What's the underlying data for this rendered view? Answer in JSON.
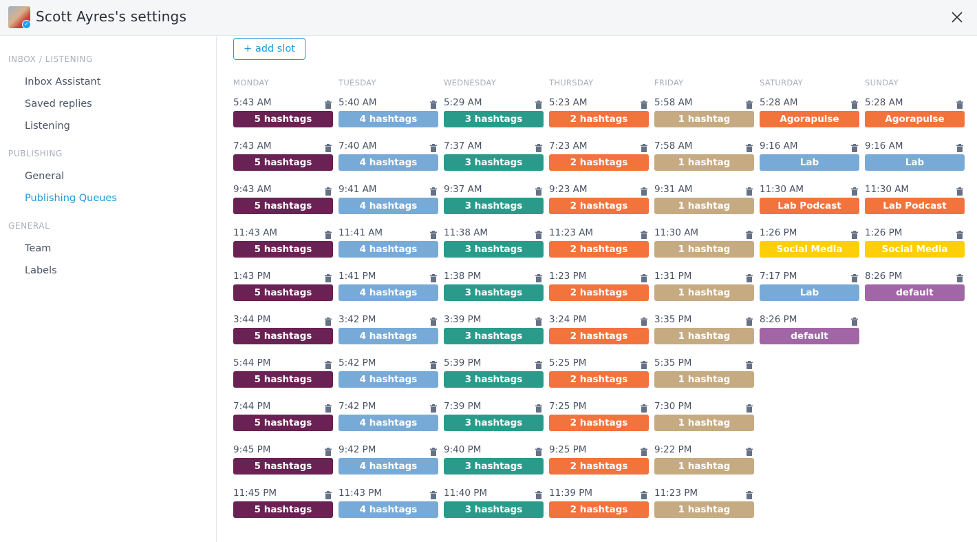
{
  "header": {
    "title": "Scott Ayres's settings",
    "badge_icon": "twitter-icon"
  },
  "sidebar": {
    "sections": [
      {
        "label": "INBOX / LISTENING",
        "items": [
          {
            "label": "Inbox Assistant",
            "active": false
          },
          {
            "label": "Saved replies",
            "active": false
          },
          {
            "label": "Listening",
            "active": false
          }
        ]
      },
      {
        "label": "PUBLISHING",
        "items": [
          {
            "label": "General",
            "active": false
          },
          {
            "label": "Publishing Queues",
            "active": true
          }
        ]
      },
      {
        "label": "GENERAL",
        "items": [
          {
            "label": "Team",
            "active": false
          },
          {
            "label": "Labels",
            "active": false
          }
        ]
      }
    ]
  },
  "main": {
    "add_slot_label": "+ add slot"
  },
  "queue_colors": {
    "5 hashtags": "#6a2153",
    "4 hashtags": "#78aad8",
    "3 hashtags": "#2a9b8b",
    "2 hashtags": "#f3733d",
    "1 hashtag": "#c6aa82",
    "Agorapulse": "#f3733d",
    "Lab": "#78aad8",
    "Lab Podcast": "#f3733d",
    "Social Media": "#fdcf06",
    "default": "#a166a6"
  },
  "days": [
    {
      "name": "MONDAY",
      "slots": [
        {
          "time": "5:43 AM",
          "queue": "5 hashtags"
        },
        {
          "time": "7:43 AM",
          "queue": "5 hashtags"
        },
        {
          "time": "9:43 AM",
          "queue": "5 hashtags"
        },
        {
          "time": "11:43 AM",
          "queue": "5 hashtags"
        },
        {
          "time": "1:43 PM",
          "queue": "5 hashtags"
        },
        {
          "time": "3:44 PM",
          "queue": "5 hashtags"
        },
        {
          "time": "5:44 PM",
          "queue": "5 hashtags"
        },
        {
          "time": "7:44 PM",
          "queue": "5 hashtags"
        },
        {
          "time": "9:45 PM",
          "queue": "5 hashtags"
        },
        {
          "time": "11:45 PM",
          "queue": "5 hashtags"
        }
      ]
    },
    {
      "name": "TUESDAY",
      "slots": [
        {
          "time": "5:40 AM",
          "queue": "4 hashtags"
        },
        {
          "time": "7:40 AM",
          "queue": "4 hashtags"
        },
        {
          "time": "9:41 AM",
          "queue": "4 hashtags"
        },
        {
          "time": "11:41 AM",
          "queue": "4 hashtags"
        },
        {
          "time": "1:41 PM",
          "queue": "4 hashtags"
        },
        {
          "time": "3:42 PM",
          "queue": "4 hashtags"
        },
        {
          "time": "5:42 PM",
          "queue": "4 hashtags"
        },
        {
          "time": "7:42 PM",
          "queue": "4 hashtags"
        },
        {
          "time": "9:42 PM",
          "queue": "4 hashtags"
        },
        {
          "time": "11:43 PM",
          "queue": "4 hashtags"
        }
      ]
    },
    {
      "name": "WEDNESDAY",
      "slots": [
        {
          "time": "5:29 AM",
          "queue": "3 hashtags"
        },
        {
          "time": "7:37 AM",
          "queue": "3 hashtags"
        },
        {
          "time": "9:37 AM",
          "queue": "3 hashtags"
        },
        {
          "time": "11:38 AM",
          "queue": "3 hashtags"
        },
        {
          "time": "1:38 PM",
          "queue": "3 hashtags"
        },
        {
          "time": "3:39 PM",
          "queue": "3 hashtags"
        },
        {
          "time": "5:39 PM",
          "queue": "3 hashtags"
        },
        {
          "time": "7:39 PM",
          "queue": "3 hashtags"
        },
        {
          "time": "9:40 PM",
          "queue": "3 hashtags"
        },
        {
          "time": "11:40 PM",
          "queue": "3 hashtags"
        }
      ]
    },
    {
      "name": "THURSDAY",
      "slots": [
        {
          "time": "5:23 AM",
          "queue": "2 hashtags"
        },
        {
          "time": "7:23 AM",
          "queue": "2 hashtags"
        },
        {
          "time": "9:23 AM",
          "queue": "2 hashtags"
        },
        {
          "time": "11:23 AM",
          "queue": "2 hashtags"
        },
        {
          "time": "1:23 PM",
          "queue": "2 hashtags"
        },
        {
          "time": "3:24 PM",
          "queue": "2 hashtags"
        },
        {
          "time": "5:25 PM",
          "queue": "2 hashtags"
        },
        {
          "time": "7:25 PM",
          "queue": "2 hashtags"
        },
        {
          "time": "9:25 PM",
          "queue": "2 hashtags"
        },
        {
          "time": "11:39 PM",
          "queue": "2 hashtags"
        }
      ]
    },
    {
      "name": "FRIDAY",
      "slots": [
        {
          "time": "5:58 AM",
          "queue": "1 hashtag"
        },
        {
          "time": "7:58 AM",
          "queue": "1 hashtag"
        },
        {
          "time": "9:31 AM",
          "queue": "1 hashtag"
        },
        {
          "time": "11:30 AM",
          "queue": "1 hashtag"
        },
        {
          "time": "1:31 PM",
          "queue": "1 hashtag"
        },
        {
          "time": "3:35 PM",
          "queue": "1 hashtag"
        },
        {
          "time": "5:35 PM",
          "queue": "1 hashtag"
        },
        {
          "time": "7:30 PM",
          "queue": "1 hashtag"
        },
        {
          "time": "9:22 PM",
          "queue": "1 hashtag"
        },
        {
          "time": "11:23 PM",
          "queue": "1 hashtag"
        }
      ]
    },
    {
      "name": "SATURDAY",
      "slots": [
        {
          "time": "5:28 AM",
          "queue": "Agorapulse"
        },
        {
          "time": "9:16 AM",
          "queue": "Lab"
        },
        {
          "time": "11:30 AM",
          "queue": "Lab Podcast"
        },
        {
          "time": "1:26 PM",
          "queue": "Social Media"
        },
        {
          "time": "7:17 PM",
          "queue": "Lab"
        },
        {
          "time": "8:26 PM",
          "queue": "default"
        }
      ]
    },
    {
      "name": "SUNDAY",
      "slots": [
        {
          "time": "5:28 AM",
          "queue": "Agorapulse"
        },
        {
          "time": "9:16 AM",
          "queue": "Lab"
        },
        {
          "time": "11:30 AM",
          "queue": "Lab Podcast"
        },
        {
          "time": "1:26 PM",
          "queue": "Social Media"
        },
        {
          "time": "8:26 PM",
          "queue": "default"
        }
      ]
    }
  ]
}
